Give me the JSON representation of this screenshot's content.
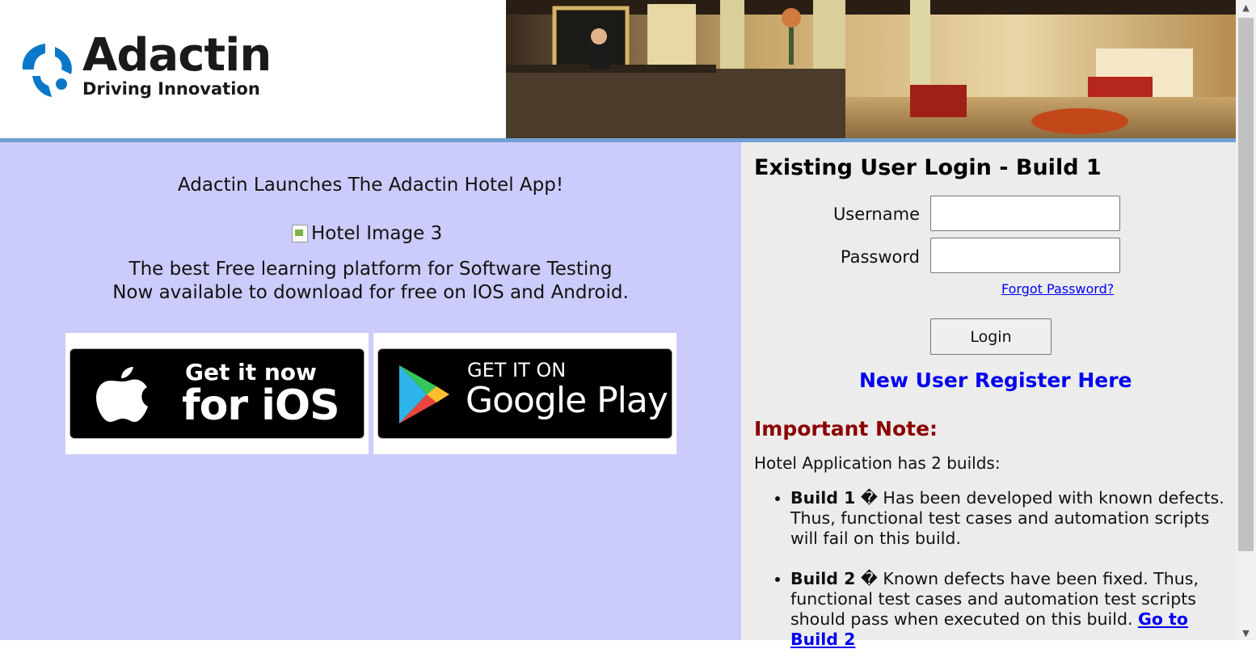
{
  "brand": {
    "name": "Adactin",
    "tagline": "Driving Innovation"
  },
  "left": {
    "announcement": "Adactin Launches The Adactin Hotel App!",
    "broken_image_alt": "Hotel Image 3",
    "tagline_line1": "The best Free learning platform for Software Testing",
    "tagline_line2": "Now available to download for free on IOS and Android.",
    "ios_badge": {
      "small": "Get it now",
      "big": "for iOS"
    },
    "google_badge": {
      "small": "GET IT ON",
      "big": "Google Play"
    }
  },
  "login": {
    "title": "Existing User Login - Build 1",
    "username_label": "Username",
    "password_label": "Password",
    "username_value": "",
    "password_value": "",
    "forgot_link": "Forgot Password?",
    "login_button": "Login",
    "register_link": "New User Register Here"
  },
  "note": {
    "title": "Important Note:",
    "intro": "Hotel Application has 2 builds:",
    "builds": [
      {
        "name": "Build 1",
        "sep": " � ",
        "text": "Has been developed with known defects. Thus, functional test cases and automation scripts will fail on this build."
      },
      {
        "name": "Build 2",
        "sep": " � ",
        "text": "Known defects have been fixed. Thus, functional test cases and automation test scripts should pass when executed on this build. ",
        "link": "Go to Build 2"
      }
    ]
  },
  "colors": {
    "left_bg": "#ccccfc",
    "right_bg": "#ececec",
    "divider": "#6f9fd3",
    "link": "#0000ee",
    "note_title": "#8b0000",
    "logo_blue": "#0a78c8"
  },
  "icons": [
    "adactin-logo-icon",
    "apple-icon",
    "google-play-icon",
    "broken-image-icon"
  ]
}
